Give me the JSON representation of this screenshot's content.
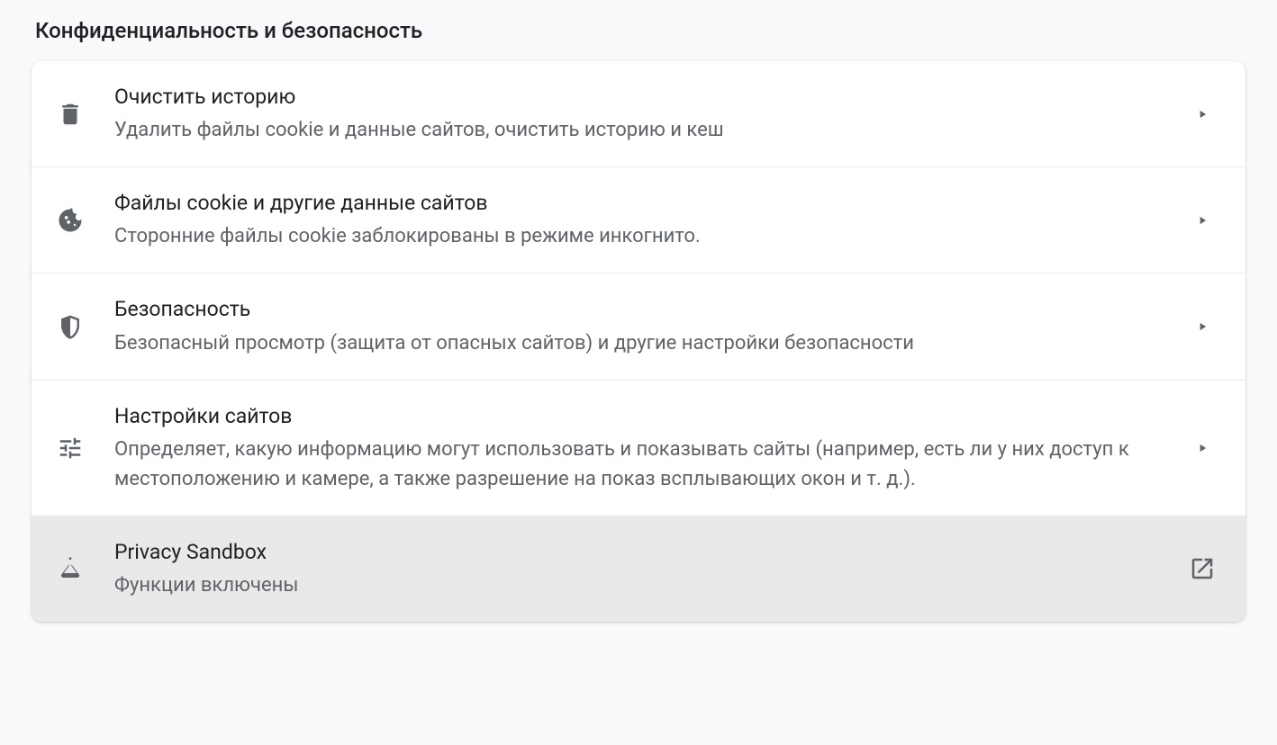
{
  "section": {
    "title": "Конфиденциальность и безопасность"
  },
  "rows": [
    {
      "icon": "trash",
      "title": "Очистить историю",
      "subtitle": "Удалить файлы cookie и данные сайтов, очистить историю и кеш",
      "action": "chevron",
      "highlight": false
    },
    {
      "icon": "cookie",
      "title": "Файлы cookie и другие данные сайтов",
      "subtitle": "Сторонние файлы cookie заблокированы в режиме инкогнито.",
      "action": "chevron",
      "highlight": false
    },
    {
      "icon": "shield",
      "title": "Безопасность",
      "subtitle": "Безопасный просмотр (защита от опасных сайтов) и другие настройки безопасности",
      "action": "chevron",
      "highlight": false
    },
    {
      "icon": "tune",
      "title": "Настройки сайтов",
      "subtitle": "Определяет, какую информацию могут использовать и показывать сайты (например, есть ли у них доступ к местоположению и камере, а также разрешение на показ всплывающих окон и т. д.).",
      "action": "chevron",
      "highlight": false
    },
    {
      "icon": "flask",
      "title": "Privacy Sandbox",
      "subtitle": "Функции включены",
      "action": "launch",
      "highlight": true
    }
  ]
}
